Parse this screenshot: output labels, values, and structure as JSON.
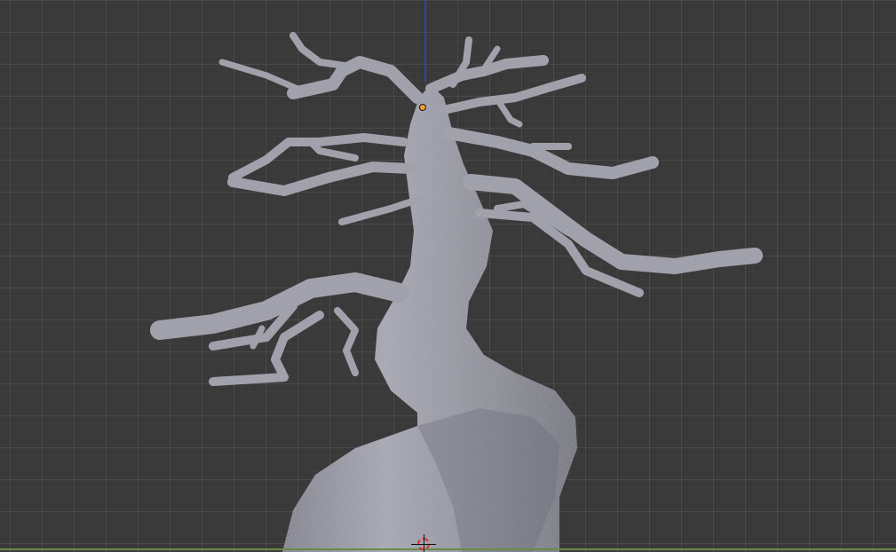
{
  "viewport": {
    "name": "3D Viewport",
    "grid": "visible",
    "background_color": "#393939",
    "grid_color": "#4a4a4a",
    "z_axis_color": "#2f3cb8",
    "ground_line_color": "#6a8b45"
  },
  "object": {
    "icon": "tree-mesh-icon",
    "color": "#9a9aa8",
    "selected_origin_color": "#f0a030"
  },
  "cursor": {
    "icon": "3d-cursor-icon"
  }
}
